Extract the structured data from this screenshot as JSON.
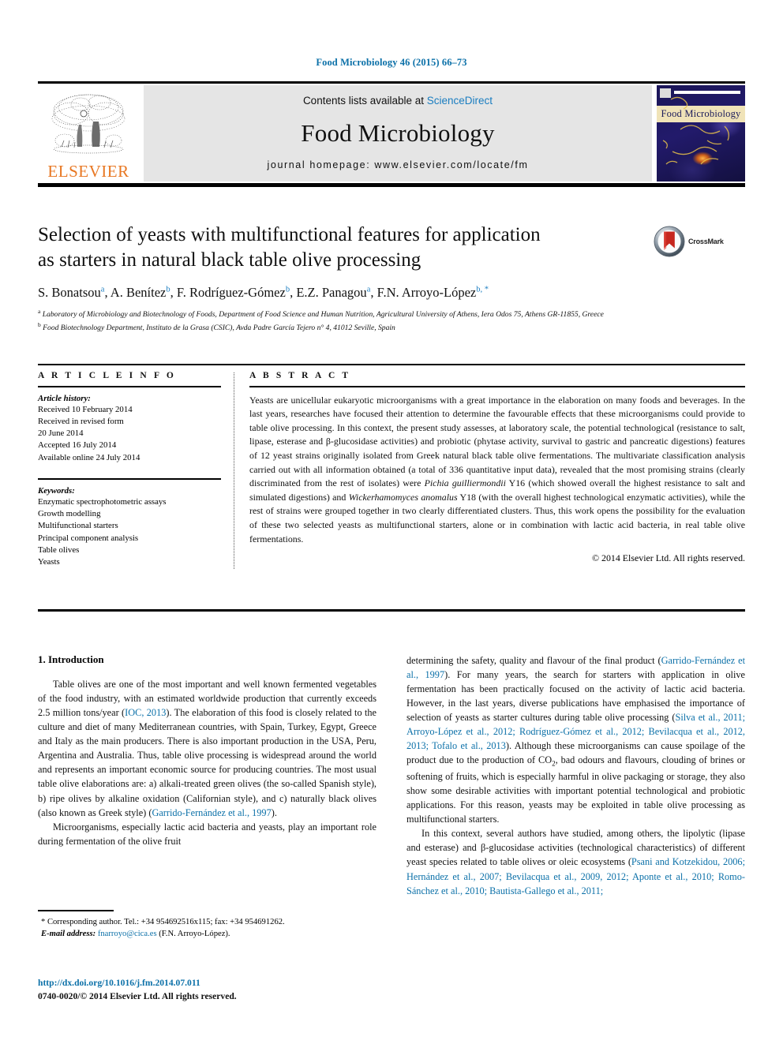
{
  "running_head": "Food Microbiology 46 (2015) 66–73",
  "masthead": {
    "contents_prefix": "Contents lists available at ",
    "sciencedirect": "ScienceDirect",
    "journal_title": "Food Microbiology",
    "homepage": "journal homepage: www.elsevier.com/locate/fm",
    "publisher_wordmark": "ELSEVIER",
    "cover_band_title": "Food Microbiology"
  },
  "article": {
    "title_line1": "Selection of yeasts with multifunctional features for application",
    "title_line2": "as starters in natural black table olive processing",
    "crossmark_label": "CrossMark",
    "authors": [
      {
        "name": "S. Bonatsou",
        "marks": "a"
      },
      {
        "name": "A. Benítez",
        "marks": "b"
      },
      {
        "name": "F. Rodríguez-Gómez",
        "marks": "b"
      },
      {
        "name": "E.Z. Panagou",
        "marks": "a"
      },
      {
        "name": "F.N. Arroyo-López",
        "marks": "b, *"
      }
    ],
    "affiliations": [
      {
        "mark": "a",
        "text": "Laboratory of Microbiology and Biotechnology of Foods, Department of Food Science and Human Nutrition, Agricultural University of Athens, Iera Odos 75, Athens GR-11855, Greece"
      },
      {
        "mark": "b",
        "text": "Food Biotechnology Department, Instituto de la Grasa (CSIC), Avda Padre García Tejero n° 4, 41012 Seville, Spain"
      }
    ]
  },
  "article_info": {
    "heading": "A R T I C L E  I N F O",
    "history_label": "Article history:",
    "history": [
      "Received 10 February 2014",
      "Received in revised form",
      "20 June 2014",
      "Accepted 16 July 2014",
      "Available online 24 July 2014"
    ],
    "keywords_label": "Keywords:",
    "keywords": [
      "Enzymatic spectrophotometric assays",
      "Growth modelling",
      "Multifunctional starters",
      "Principal component analysis",
      "Table olives",
      "Yeasts"
    ]
  },
  "abstract": {
    "heading": "A B S T R A C T",
    "part1": "Yeasts are unicellular eukaryotic microorganisms with a great importance in the elaboration on many foods and beverages. In the last years, researches have focused their attention to determine the favourable effects that these microorganisms could provide to table olive processing. In this context, the present study assesses, at laboratory scale, the potential technological (resistance to salt, lipase, esterase and β-glucosidase activities) and probiotic (phytase activity, survival to gastric and pancreatic digestions) features of 12 yeast strains originally isolated from Greek natural black table olive fermentations. The multivariate classification analysis carried out with all information obtained (a total of 336 quantitative input data), revealed that the most promising strains (clearly discriminated from the rest of isolates) were ",
    "italic1": "Pichia guilliermondii",
    "part2": " Y16 (which showed overall the highest resistance to salt and simulated digestions) and ",
    "italic2": "Wickerhamomyces anomalus",
    "part3": " Y18 (with the overall highest technological enzymatic activities), while the rest of strains were grouped together in two clearly differentiated clusters. Thus, this work opens the possibility for the evaluation of these two selected yeasts as multifunctional starters, alone or in combination with lactic acid bacteria, in real table olive fermentations.",
    "copyright": "© 2014 Elsevier Ltd. All rights reserved."
  },
  "introduction": {
    "heading": "1. Introduction",
    "left_paragraphs": [
      "Table olives are one of the most important and well known fermented vegetables of the food industry, with an estimated worldwide production that currently exceeds 2.5 million tons/year (IOC, 2013). The elaboration of this food is closely related to the culture and diet of many Mediterranean countries, with Spain, Turkey, Egypt, Greece and Italy as the main producers. There is also important production in the USA, Peru, Argentina and Australia. Thus, table olive processing is widespread around the world and represents an important economic source for producing countries. The most usual table olive elaborations are: a) alkali-treated green olives (the so-called Spanish style), b) ripe olives by alkaline oxidation (Californian style), and c) naturally black olives (also known as Greek style) (Garrido-Fernández et al., 1997).",
      "Microorganisms, especially lactic acid bacteria and yeasts, play an important role during fermentation of the olive fruit"
    ],
    "left_citations": [
      "IOC, 2013",
      "Garrido-Fernández et al., 1997"
    ],
    "right_paragraphs": [
      "determining the safety, quality and flavour of the final product (Garrido-Fernández et al., 1997). For many years, the search for starters with application in olive fermentation has been practically focused on the activity of lactic acid bacteria. However, in the last years, diverse publications have emphasised the importance of selection of yeasts as starter cultures during table olive processing (Silva et al., 2011; Arroyo-López et al., 2012; Rodríguez-Gómez et al., 2012; Bevilacqua et al., 2012, 2013; Tofalo et al., 2013). Although these microorganisms can cause spoilage of the product due to the production of CO2, bad odours and flavours, clouding of brines or softening of fruits, which is especially harmful in olive packaging or storage, they also show some desirable activities with important potential technological and probiotic applications. For this reason, yeasts may be exploited in table olive processing as multifunctional starters.",
      "In this context, several authors have studied, among others, the lipolytic (lipase and esterase) and β-glucosidase activities (technological characteristics) of different yeast species related to table olives or oleic ecosystems (Psani and Kotzekidou, 2006; Hernández et al., 2007; Bevilacqua et al., 2009, 2012; Aponte et al., 2010; Romo-Sánchez et al., 2010; Bautista-Gallego et al., 2011;"
    ],
    "right_citations": [
      "Garrido-Fernández et al., 1997",
      "Silva et al., 2011; Arroyo-López et al., 2012; Rodríguez-Gómez et al., 2012; Bevilacqua et al., 2012, 2013; Tofalo et al., 2013",
      "Psani and Kotzekidou, 2006; Hernández et al., 2007; Bevilacqua et al., 2009, 2012; Aponte et al., 2010; Romo-Sánchez et al., 2010; Bautista-Gallego et al., 2011;"
    ]
  },
  "footnote": {
    "corresponding": "* Corresponding author. Tel.: +34 954692516x115; fax: +34 954691262.",
    "email_label": "E-mail address:",
    "email": "fnarroyo@cica.es",
    "email_suffix": " (F.N. Arroyo-López)."
  },
  "footer": {
    "doi": "http://dx.doi.org/10.1016/j.fm.2014.07.011",
    "issn": "0740-0020/© 2014 Elsevier Ltd. All rights reserved."
  },
  "colors": {
    "link_blue": "#0b70a8",
    "sciencedirect_blue": "#1a7dc0",
    "elsevier_orange": "#E87722",
    "panel_grey": "#e5e5e5"
  }
}
